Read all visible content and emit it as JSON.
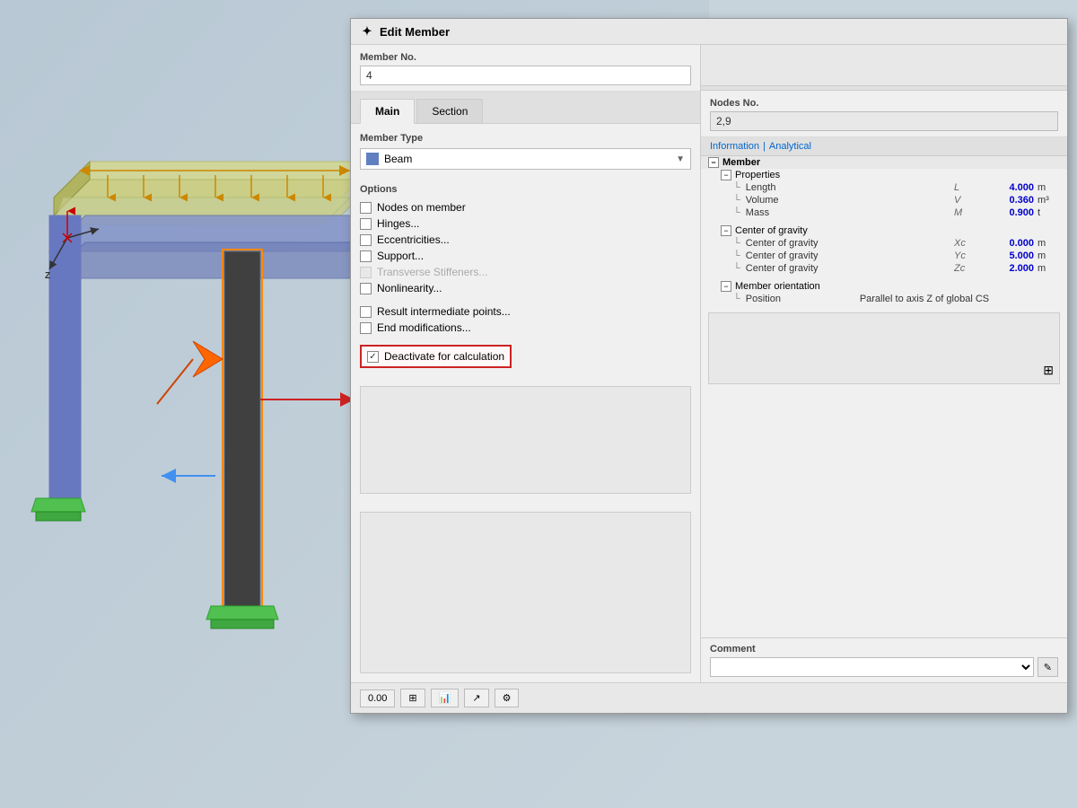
{
  "dialog": {
    "title": "Edit Member",
    "icon": "✦"
  },
  "left_panel": {
    "member_no_label": "Member No.",
    "member_no_value": "4",
    "tabs": [
      {
        "label": "Main",
        "active": true
      },
      {
        "label": "Section",
        "active": false
      }
    ],
    "member_type_label": "Member Type",
    "member_type_value": "Beam",
    "options_label": "Options",
    "options": [
      {
        "label": "Nodes on member",
        "checked": false,
        "disabled": false
      },
      {
        "label": "Hinges...",
        "checked": false,
        "disabled": false
      },
      {
        "label": "Eccentricities...",
        "checked": false,
        "disabled": false
      },
      {
        "label": "Support...",
        "checked": false,
        "disabled": false
      },
      {
        "label": "Transverse Stiffeners...",
        "checked": false,
        "disabled": true
      },
      {
        "label": "Nonlinearity...",
        "checked": false,
        "disabled": false
      }
    ],
    "result_intermediate_label": "Result intermediate points...",
    "end_modifications_label": "End modifications...",
    "deactivate_label": "Deactivate for calculation",
    "deactivate_checked": true
  },
  "right_panel": {
    "nodes_no_label": "Nodes No.",
    "nodes_no_value": "2,9",
    "info_header": {
      "label": "Information",
      "separator": "|",
      "analytical_label": "Analytical"
    },
    "tree": {
      "member_label": "Member",
      "properties_label": "Properties",
      "props": [
        {
          "name": "Length",
          "symbol": "L",
          "value": "4.000",
          "unit": "m"
        },
        {
          "name": "Volume",
          "symbol": "V",
          "value": "0.360",
          "unit": "m³"
        },
        {
          "name": "Mass",
          "symbol": "M",
          "value": "0.900",
          "unit": "t"
        }
      ],
      "center_gravity_label": "Center of gravity",
      "cog_items": [
        {
          "name": "Center of gravity",
          "symbol": "Xc",
          "value": "0.000",
          "unit": "m"
        },
        {
          "name": "Center of gravity",
          "symbol": "Yc",
          "value": "5.000",
          "unit": "m"
        },
        {
          "name": "Center of gravity",
          "symbol": "Zc",
          "value": "2.000",
          "unit": "m"
        }
      ],
      "member_orientation_label": "Member orientation",
      "position_label": "Position",
      "position_value": "Parallel to axis Z of global CS"
    }
  },
  "comment": {
    "label": "Comment",
    "placeholder": ""
  },
  "toolbar": {
    "buttons": [
      {
        "label": "0.00",
        "icon": "num"
      },
      {
        "label": "",
        "icon": "table"
      },
      {
        "label": "",
        "icon": "graph"
      },
      {
        "label": "",
        "icon": "arrow"
      },
      {
        "label": "",
        "icon": "settings"
      }
    ]
  }
}
